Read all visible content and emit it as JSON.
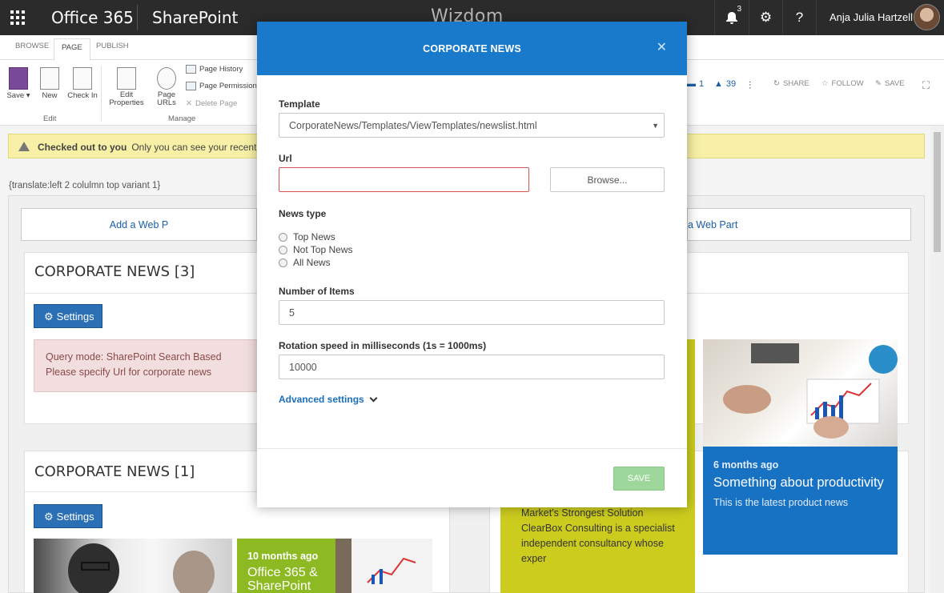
{
  "suitebar": {
    "app_name": "Office 365",
    "site_name": "SharePoint",
    "logo_text": "Wizdom",
    "notification_count": "3",
    "user_name": "Anja Julia Hartzell"
  },
  "ribbon": {
    "tabs": [
      "BROWSE",
      "PAGE",
      "PUBLISH"
    ],
    "buttons": {
      "save": "Save",
      "new": "New",
      "check_in": "Check In",
      "edit_properties": "Edit Properties",
      "page_urls": "Page URLs"
    },
    "small_buttons": [
      "Page History",
      "Page Permissions",
      "Delete Page"
    ],
    "groups": {
      "edit": "Edit",
      "manage": "Manage"
    },
    "right": {
      "comments": "1",
      "likes": "39",
      "share": "SHARE",
      "follow": "FOLLOW",
      "save": "SAVE"
    }
  },
  "page": {
    "checked_out_title": "Checked out to you",
    "checked_out_text": "Only you can see your recent c",
    "translate_text": "{translate:left 2 colulmn top variant 1}",
    "add_web_part_left": "Add a Web P",
    "add_web_part_right": "a Web Part",
    "wp1_title": "CORPORATE NEWS [3]",
    "wp2_title": "CORPORATE NEWS [1]",
    "settings_label": "Settings",
    "notice_line1": "Query mode: SharePoint Search Based",
    "notice_line2": "Please specify Url for corporate news",
    "blue_tile": {
      "ago": "6 months ago",
      "headline": "Something about productivity",
      "desc": "This is the latest product news"
    },
    "green_text": "Market's Strongest Solution ClearBox Consulting is a specialist independent consultancy whose exper",
    "green2_tile": {
      "ago": "10 months ago",
      "headline": "Office 365 & SharePoint"
    }
  },
  "modal": {
    "title": "CORPORATE NEWS",
    "template_label": "Template",
    "template_value": "CorporateNews/Templates/ViewTemplates/newslist.html",
    "url_label": "Url",
    "url_value": "",
    "browse_label": "Browse...",
    "news_type_label": "News type",
    "news_types": [
      "Top News",
      "Not Top News",
      "All News"
    ],
    "items_label": "Number of Items",
    "items_value": "5",
    "rotation_label": "Rotation speed in milliseconds (1s = 1000ms)",
    "rotation_value": "10000",
    "advanced_label": "Advanced settings",
    "save_label": "SAVE"
  },
  "colors": {
    "suitebar": "#2b2b2b",
    "modal_header": "#1979ca",
    "tile_blue": "#1872c4",
    "tile_green": "#cccc1f",
    "save_disabled": "#9ed79c"
  }
}
